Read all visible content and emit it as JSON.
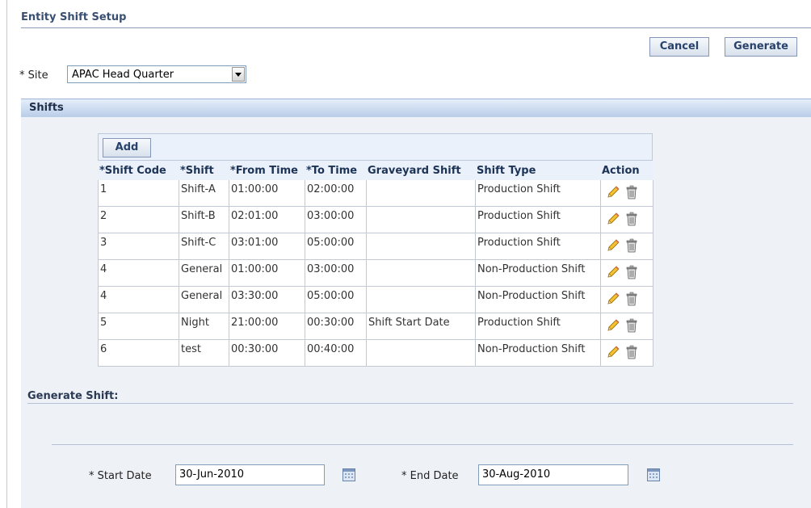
{
  "page": {
    "title": "Entity Shift Setup"
  },
  "header_buttons": {
    "cancel": "Cancel",
    "generate": "Generate"
  },
  "site": {
    "label": "* Site",
    "value": "APAC Head Quarter"
  },
  "shifts": {
    "section_title": "Shifts",
    "add_label": "Add",
    "columns": [
      "*Shift Code",
      "*Shift",
      "*From Time",
      "*To Time",
      "Graveyard Shift",
      "Shift Type",
      "Action"
    ],
    "rows": [
      {
        "code": "1",
        "shift": "Shift-A",
        "from": "01:00:00",
        "to": "02:00:00",
        "graveyard": "",
        "type": "Production Shift"
      },
      {
        "code": "2",
        "shift": "Shift-B",
        "from": "02:01:00",
        "to": "03:00:00",
        "graveyard": "",
        "type": "Production Shift"
      },
      {
        "code": "3",
        "shift": "Shift-C",
        "from": "03:01:00",
        "to": "05:00:00",
        "graveyard": "",
        "type": "Production Shift"
      },
      {
        "code": "4",
        "shift": "General",
        "from": "01:00:00",
        "to": "03:00:00",
        "graveyard": "",
        "type": "Non-Production Shift"
      },
      {
        "code": "4",
        "shift": "General",
        "from": "03:30:00",
        "to": "05:00:00",
        "graveyard": "",
        "type": "Non-Production Shift"
      },
      {
        "code": "5",
        "shift": "Night",
        "from": "21:00:00",
        "to": "00:30:00",
        "graveyard": "Shift Start Date",
        "type": "Production Shift"
      },
      {
        "code": "6",
        "shift": "test",
        "from": "00:30:00",
        "to": "00:40:00",
        "graveyard": "",
        "type": "Non-Production Shift"
      }
    ]
  },
  "generate": {
    "section_title": "Generate Shift:",
    "start_label": "* Start Date",
    "start_value": "30-Jun-2010",
    "end_label": "* End Date",
    "end_value": "30-Aug-2010"
  },
  "icons": {
    "edit": "pencil-icon",
    "delete": "trash-icon",
    "calendar": "calendar-icon"
  }
}
